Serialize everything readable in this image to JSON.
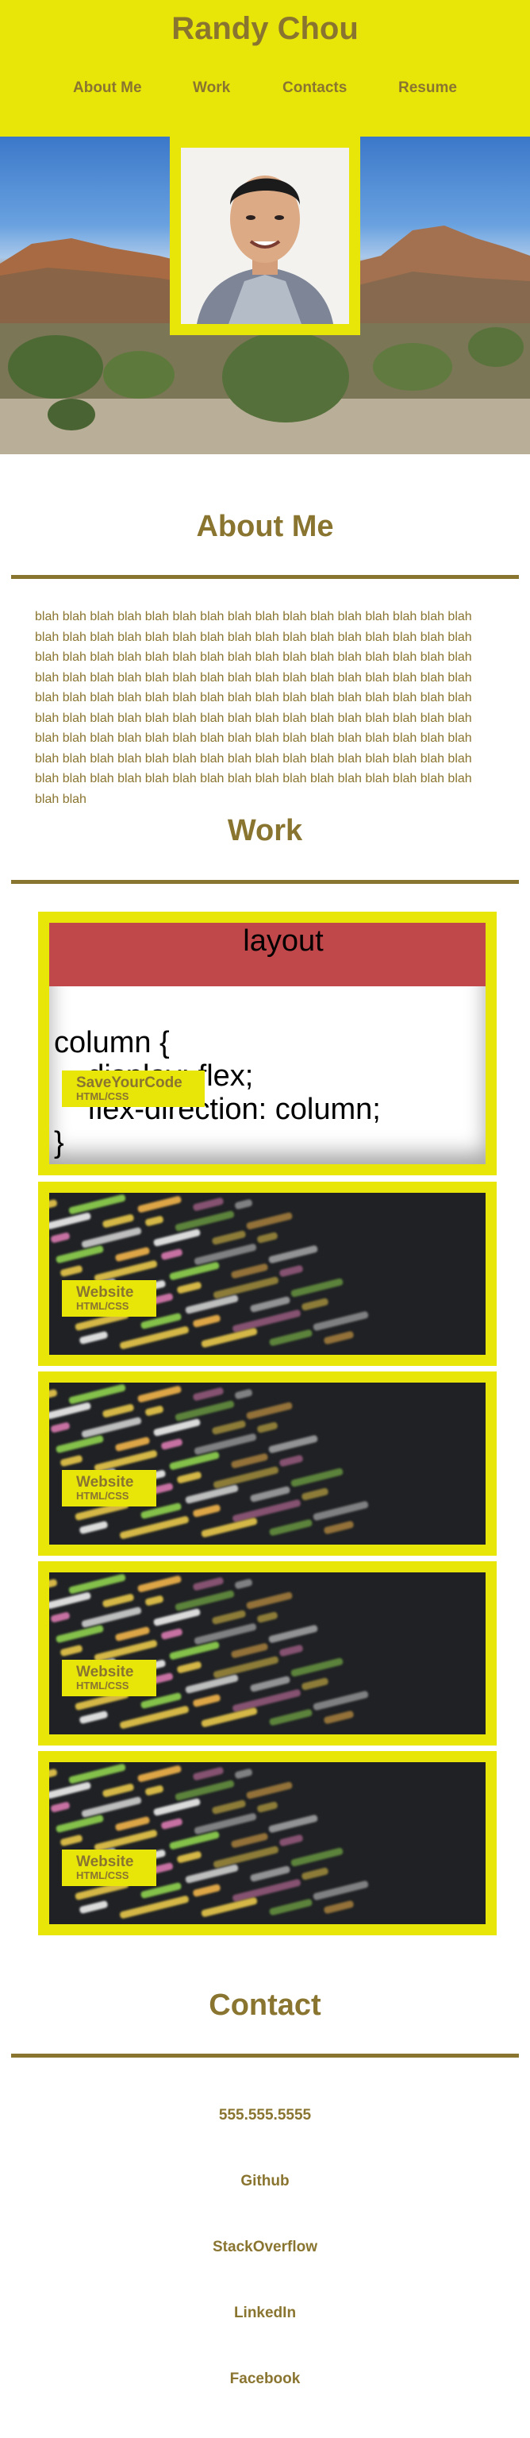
{
  "header": {
    "title": "Randy Chou",
    "nav": [
      "About Me",
      "Work",
      "Contacts",
      "Resume"
    ]
  },
  "about": {
    "heading": "About Me",
    "text": "blah blah blah blah blah blah blah blah blah blah blah blah blah blah blah blah blah blah blah blah blah blah blah blah blah blah blah blah blah blah blah blah blah blah blah blah blah blah blah blah blah blah blah blah blah blah blah blah blah blah blah blah blah blah blah blah blah blah blah blah blah blah blah blah blah blah blah blah blah blah blah blah blah blah blah blah blah blah blah blah blah blah blah blah blah blah blah blah blah blah blah blah blah blah blah blah blah blah blah blah blah blah blah blah blah blah blah blah blah blah blah blah blah blah blah blah blah blah blah blah blah blah blah blah blah blah blah blah blah blah blah blah blah blah blah blah blah blah blah blah blah blah blah blah blah blah"
  },
  "work": {
    "heading": "Work",
    "featured": {
      "name": "SaveYourCode",
      "tag": "HTML/CSS",
      "screenshot_title": "layout",
      "screenshot_code": "column {\n    display: flex;\n    flex-direction: column;\n}"
    },
    "cards": [
      {
        "name": "Website",
        "tag": "HTML/CSS"
      },
      {
        "name": "Website",
        "tag": "HTML/CSS"
      },
      {
        "name": "Website",
        "tag": "HTML/CSS"
      },
      {
        "name": "Website",
        "tag": "HTML/CSS"
      }
    ]
  },
  "contact": {
    "heading": "Contact",
    "items": [
      "555.555.5555",
      "Github",
      "StackOverflow",
      "LinkedIn",
      "Facebook"
    ]
  },
  "colors": {
    "accent_yellow": "#e8e609",
    "text_olive": "#8a7530",
    "layout_header_red": "#c0474a"
  }
}
